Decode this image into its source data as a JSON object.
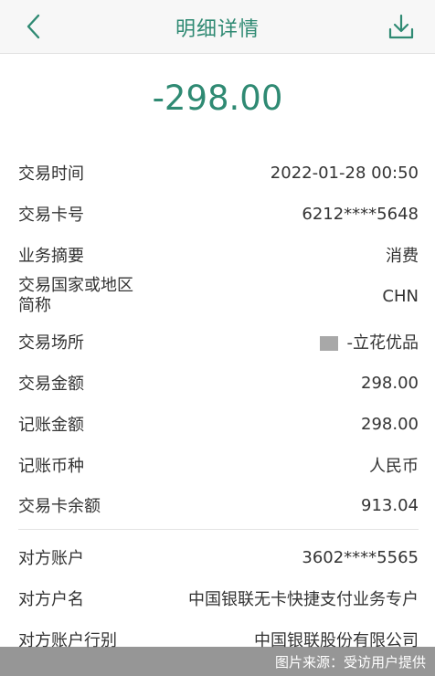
{
  "header": {
    "title": "明细详情",
    "back_icon": "chevron-left-icon",
    "download_icon": "download-icon"
  },
  "amount": "-298.00",
  "colors": {
    "accent": "#2f8a73"
  },
  "details": [
    {
      "label": "交易时间",
      "value": "2022-01-28 00:50"
    },
    {
      "label": "交易卡号",
      "value": "6212****5648"
    },
    {
      "label": "业务摘要",
      "value": "消费"
    },
    {
      "label": "交易国家或地区简称",
      "label_line1": "交易国家或地区",
      "label_line2": "简称",
      "value": "CHN"
    },
    {
      "label": "交易场所",
      "value": "-立花优品"
    },
    {
      "label": "交易金额",
      "value": "298.00"
    },
    {
      "label": "记账金额",
      "value": "298.00"
    },
    {
      "label": "记账币种",
      "value": "人民币"
    },
    {
      "label": "交易卡余额",
      "value": "913.04"
    }
  ],
  "counterparty": [
    {
      "label": "对方账户",
      "value": "3602****5565"
    },
    {
      "label": "对方户名",
      "value": "中国银联无卡快捷支付业务专户"
    },
    {
      "label": "对方账户行别",
      "value": "中国银联股份有限公司"
    }
  ],
  "watermark": "图片来源：受访用户提供"
}
